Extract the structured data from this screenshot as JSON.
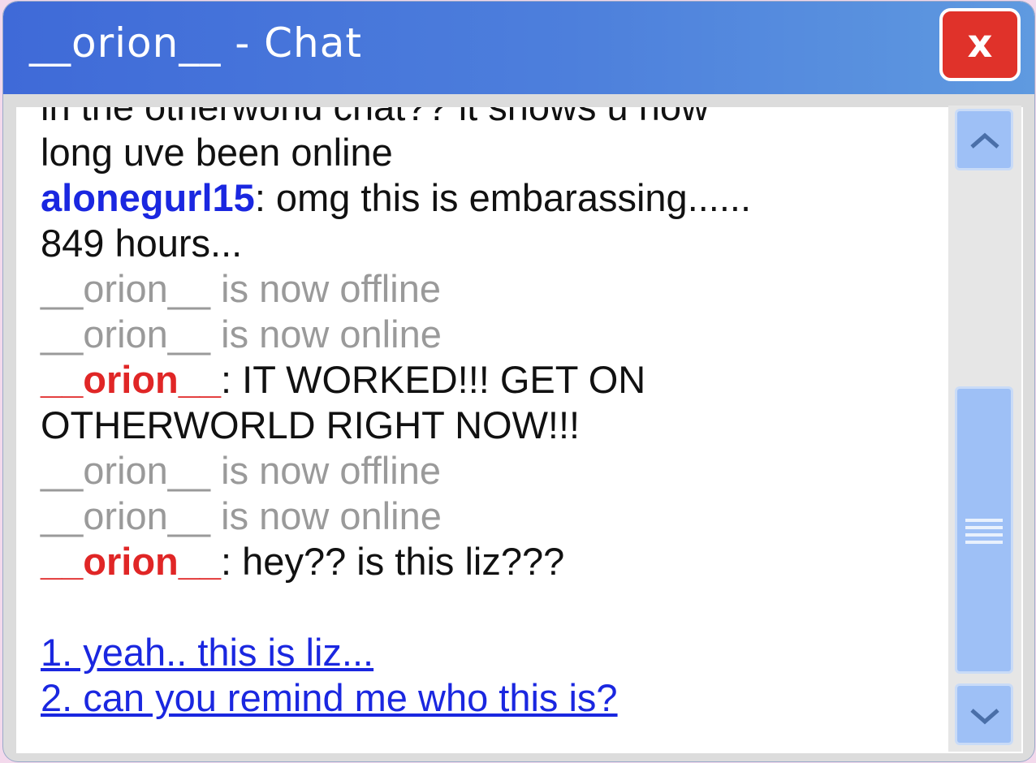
{
  "window": {
    "title": "__orion__ - Chat",
    "close_label": "x"
  },
  "chat": {
    "partial_top": "in the otherworld chat?? it shows u how",
    "line_long": "long uve been online",
    "msg1_user": "alonegurl15",
    "msg1_text": ": omg this is embarassing......",
    "msg1_cont": "849 hours...",
    "sys1": "__orion__ is now offline",
    "sys2": "__orion__ is now online",
    "msg2_user": "__orion__",
    "msg2_text": ": IT WORKED!!! GET ON",
    "msg2_cont": "OTHERWORLD RIGHT NOW!!!",
    "sys3": "__orion__ is now offline",
    "sys4": "__orion__ is now online",
    "msg3_user": "__orion__",
    "msg3_text": ": hey?? is this liz???"
  },
  "choices": [
    "1. yeah.. this is liz...",
    "2. can you remind me who this is?"
  ],
  "colors": {
    "titlebar": "#4a78d9",
    "close": "#e0322a",
    "user_blue": "#1a27e0",
    "user_red": "#e02626",
    "system": "#9a9a9a",
    "scrollbar": "#9ec0f6"
  },
  "icons": {
    "up": "chevron-up-icon",
    "down": "chevron-down-icon",
    "grip": "grip-lines-icon"
  }
}
